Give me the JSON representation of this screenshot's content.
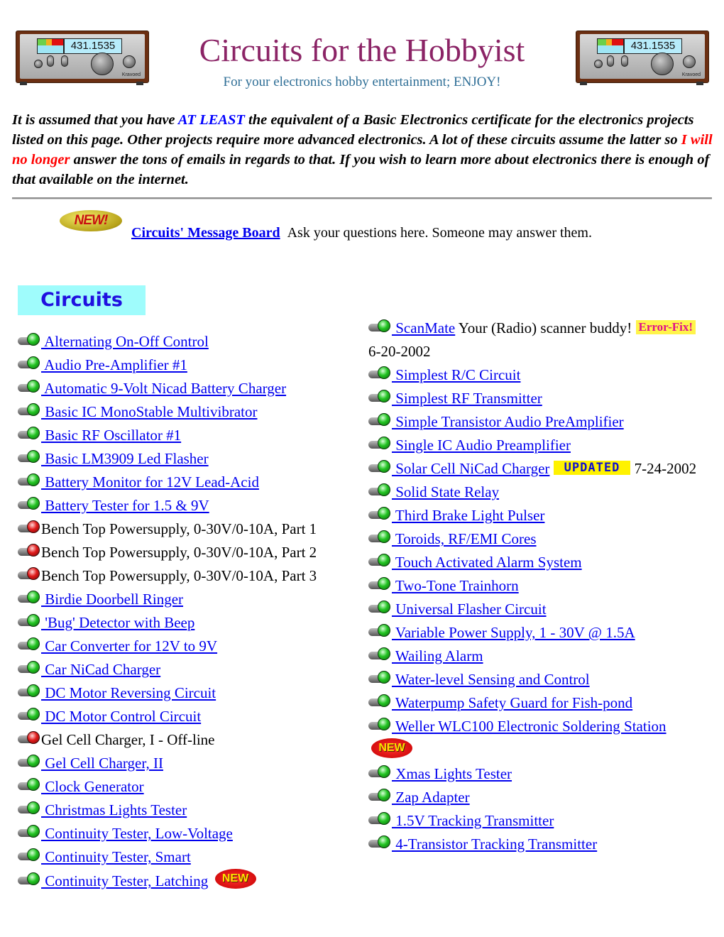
{
  "header": {
    "title": "Circuits for the Hobbyist",
    "subtitle": "For your electronics hobby entertainment; ENJOY!",
    "radio_display": "431.1535",
    "radio_brand": "Kravoed"
  },
  "intro": {
    "part1": "It is assumed that you have ",
    "emph_blue": "AT LEAST",
    "part2": " the equivalent of a Basic Electronics certificate for the electronics projects listed on this page. Other projects require more advanced electronics. A lot of these circuits assume the latter so ",
    "emph_red": "I will no longer",
    "part3": " answer the tons of emails in regards to that. If you wish to learn more about electronics there is enough of that available on the internet."
  },
  "message_board": {
    "badge": "NEW!",
    "link": "Circuits' Message Board",
    "text": "Ask your questions here. Someone may answer them."
  },
  "section_banner": "Circuits",
  "left_column": [
    {
      "label": "Alternating On-Off Control",
      "status": "green",
      "link": true
    },
    {
      "label": "Audio Pre-Amplifier #1",
      "status": "green",
      "link": true
    },
    {
      "label": "Automatic 9-Volt Nicad Battery Charger",
      "status": "green",
      "link": true
    },
    {
      "label": "Basic IC MonoStable Multivibrator",
      "status": "green",
      "link": true
    },
    {
      "label": "Basic RF Oscillator #1",
      "status": "green",
      "link": true
    },
    {
      "label": "Basic LM3909 Led Flasher",
      "status": "green",
      "link": true
    },
    {
      "label": "Battery Monitor for 12V Lead-Acid",
      "status": "green",
      "link": true
    },
    {
      "label": "Battery Tester for 1.5 & 9V",
      "status": "green",
      "link": true
    },
    {
      "label": "Bench Top Powersupply, 0-30V/0-10A, Part 1",
      "status": "red",
      "link": false
    },
    {
      "label": "Bench Top Powersupply, 0-30V/0-10A, Part 2",
      "status": "red",
      "link": false
    },
    {
      "label": "Bench Top Powersupply, 0-30V/0-10A, Part 3",
      "status": "red",
      "link": false
    },
    {
      "label": "Birdie Doorbell Ringer",
      "status": "green",
      "link": true
    },
    {
      "label": "'Bug' Detector with Beep",
      "status": "green",
      "link": true
    },
    {
      "label": "Car Converter for 12V to 9V",
      "status": "green",
      "link": true
    },
    {
      "label": "Car NiCad Charger",
      "status": "green",
      "link": true
    },
    {
      "label": "DC Motor Reversing Circuit",
      "status": "green",
      "link": true
    },
    {
      "label": "DC Motor Control Circuit",
      "status": "green",
      "link": true
    },
    {
      "label": "Gel Cell Charger, I - Off-line",
      "status": "red",
      "link": false
    },
    {
      "label": "Gel Cell Charger, II",
      "status": "green",
      "link": true
    },
    {
      "label": "Clock Generator",
      "status": "green",
      "link": true
    },
    {
      "label": "Christmas Lights Tester",
      "status": "green",
      "link": true
    },
    {
      "label": "Continuity Tester, Low-Voltage",
      "status": "green",
      "link": true
    },
    {
      "label": "Continuity Tester, Smart",
      "status": "green",
      "link": true
    },
    {
      "label": "Continuity Tester, Latching",
      "status": "green",
      "link": true,
      "badge": "NEW"
    }
  ],
  "right_column": [
    {
      "label": "ScanMate",
      "status": "green",
      "link": true,
      "suffix": "Your (Radio) scanner buddy!",
      "badge": "Error-Fix!",
      "date": "6-20-2002"
    },
    {
      "label": "Simplest R/C Circuit",
      "status": "green",
      "link": true
    },
    {
      "label": "Simplest RF Transmitter",
      "status": "green",
      "link": true
    },
    {
      "label": "Simple Transistor Audio PreAmplifier",
      "status": "green",
      "link": true
    },
    {
      "label": "Single IC Audio Preamplifier",
      "status": "green",
      "link": true
    },
    {
      "label": "Solar Cell NiCad Charger",
      "status": "green",
      "link": true,
      "badge": "UPDATED",
      "date": "7-24-2002"
    },
    {
      "label": "Solid State Relay",
      "status": "green",
      "link": true
    },
    {
      "label": "Third Brake Light Pulser",
      "status": "green",
      "link": true
    },
    {
      "label": "Toroids, RF/EMI Cores",
      "status": "green",
      "link": true
    },
    {
      "label": "Touch Activated Alarm System",
      "status": "green",
      "link": true
    },
    {
      "label": "Two-Tone Trainhorn",
      "status": "green",
      "link": true
    },
    {
      "label": "Universal Flasher Circuit",
      "status": "green",
      "link": true
    },
    {
      "label": "Variable Power Supply, 1 - 30V @ 1.5A",
      "status": "green",
      "link": true
    },
    {
      "label": "Wailing Alarm",
      "status": "green",
      "link": true
    },
    {
      "label": "Water-level Sensing and Control",
      "status": "green",
      "link": true
    },
    {
      "label": "Waterpump Safety Guard for Fish-pond",
      "status": "green",
      "link": true
    },
    {
      "label": "Weller WLC100 Electronic Soldering Station",
      "status": "green",
      "link": true,
      "badge": "NEW"
    },
    {
      "label": "Xmas Lights Tester",
      "status": "green",
      "link": true
    },
    {
      "label": "Zap Adapter",
      "status": "green",
      "link": true
    },
    {
      "label": "1.5V Tracking Transmitter",
      "status": "green",
      "link": true
    },
    {
      "label": "4-Transistor Tracking Transmitter",
      "status": "green",
      "link": true
    }
  ]
}
